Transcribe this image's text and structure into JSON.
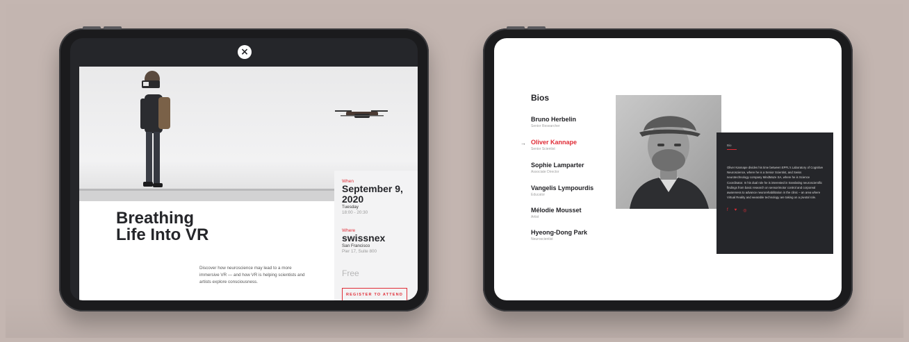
{
  "left_screen": {
    "close_icon": "close-icon",
    "title_line1": "Breathing",
    "title_line2": "Life Into VR",
    "description": "Discover how neuroscience may lead to a more immersive VR — and how VR is helping scientists and artists explore consciousness.",
    "when_label": "When",
    "date": "September 9, 2020",
    "weekday": "Tuesday",
    "time": "18:00 - 20:30",
    "where_label": "Where",
    "venue": "swissnex",
    "city": "San Francisco",
    "address": "Pier 17, Suite 800",
    "price": "Free",
    "register_label": "REGISTER TO ATTEND"
  },
  "right_screen": {
    "bios_title": "Bios",
    "arrow": "→",
    "people": [
      {
        "name": "Bruno Herbelin",
        "role": "Senior Researcher"
      },
      {
        "name": "Oliver Kannape",
        "role": "Senior Scientist"
      },
      {
        "name": "Sophie Lamparter",
        "role": "Associate Director"
      },
      {
        "name": "Vangelis Lympourdis",
        "role": "Educator"
      },
      {
        "name": "Mélodie Mousset",
        "role": "Artist"
      },
      {
        "name": "Hyeong-Dong Park",
        "role": "Neuroscientist"
      }
    ],
    "bio_card": {
      "label": "Bio",
      "text": "Oliver Kannape divides his time between EPFL's Laboratory of Cognitive Neuroscience, where he is a Senior Scientist, and Swiss neurotechnology company MindMaze SA, where he is Science Coordinator. In his dual role he is interested in translating neuroscientific findings from basic research on sensorimotor control and corporeal awareness to advance neurorehabilitation in the clinic – an area where Virtual Reality and wearable technology are taking on a pivotal role.",
      "social_facebook": "f",
      "social_twitter": "♥",
      "social_instagram": "◎"
    }
  },
  "colors": {
    "accent": "#e02c36",
    "dark": "#25262a",
    "background": "#c4b6b1"
  }
}
